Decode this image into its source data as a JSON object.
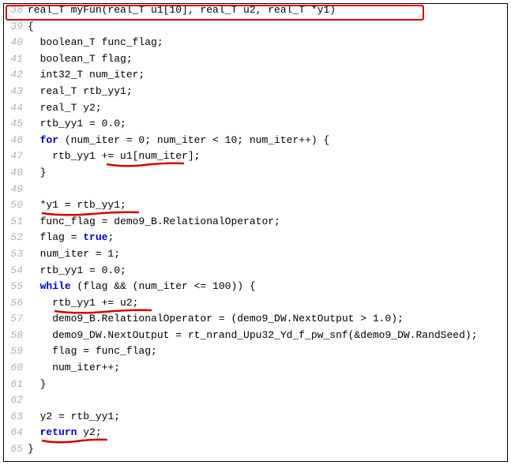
{
  "keywords": {
    "for": "for",
    "while": "while",
    "return": "return",
    "true": "true"
  },
  "lines": {
    "l38": {
      "num": "38",
      "a": "real_T myFun(real_T u1[10], real_T u2, real_T *y1)"
    },
    "l39": {
      "num": "39",
      "a": "{"
    },
    "l40": {
      "num": "40",
      "a": "  boolean_T func_flag;"
    },
    "l41": {
      "num": "41",
      "a": "  boolean_T flag;"
    },
    "l42": {
      "num": "42",
      "a": "  int32_T num_iter;"
    },
    "l43": {
      "num": "43",
      "a": "  real_T rtb_yy1;"
    },
    "l44": {
      "num": "44",
      "a": "  real_T y2;"
    },
    "l45": {
      "num": "45",
      "a": "  rtb_yy1 = 0.0;"
    },
    "l46": {
      "num": "46",
      "a": "  ",
      "b": " (num_iter = 0; num_iter < 10; num_iter++) {"
    },
    "l47": {
      "num": "47",
      "a": "    rtb_yy1 += u1[num_iter];"
    },
    "l48": {
      "num": "48",
      "a": "  }"
    },
    "l49": {
      "num": "49",
      "a": ""
    },
    "l50": {
      "num": "50",
      "a": "  *y1 = rtb_yy1;"
    },
    "l51": {
      "num": "51",
      "a": "  func_flag = demo9_B.RelationalOperator;"
    },
    "l52": {
      "num": "52",
      "a": "  flag = ",
      "b": ";"
    },
    "l53": {
      "num": "53",
      "a": "  num_iter = 1;"
    },
    "l54": {
      "num": "54",
      "a": "  rtb_yy1 = 0.0;"
    },
    "l55": {
      "num": "55",
      "a": "  ",
      "b": " (flag && (num_iter <= 100)) {"
    },
    "l56": {
      "num": "56",
      "a": "    rtb_yy1 += u2;"
    },
    "l57": {
      "num": "57",
      "a": "    demo9_B.RelationalOperator = (demo9_DW.NextOutput > 1.0);"
    },
    "l58": {
      "num": "58",
      "a": "    demo9_DW.NextOutput = rt_nrand_Upu32_Yd_f_pw_snf(&demo9_DW.RandSeed);"
    },
    "l59": {
      "num": "59",
      "a": "    flag = func_flag;"
    },
    "l60": {
      "num": "60",
      "a": "    num_iter++;"
    },
    "l61": {
      "num": "61",
      "a": "  }"
    },
    "l62": {
      "num": "62",
      "a": ""
    },
    "l63": {
      "num": "63",
      "a": "  y2 = rtb_yy1;"
    },
    "l64": {
      "num": "64",
      "a": "  ",
      "b": " y2;"
    },
    "l65": {
      "num": "65",
      "a": "}"
    }
  }
}
